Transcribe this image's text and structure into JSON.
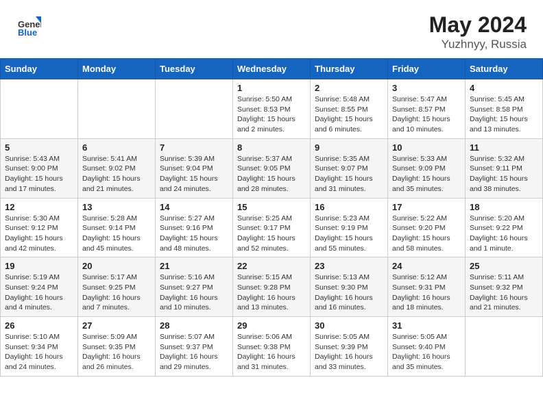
{
  "header": {
    "logo_general": "General",
    "logo_blue": "Blue",
    "title": "May 2024",
    "location": "Yuzhnyy, Russia"
  },
  "days_of_week": [
    "Sunday",
    "Monday",
    "Tuesday",
    "Wednesday",
    "Thursday",
    "Friday",
    "Saturday"
  ],
  "weeks": [
    [
      {
        "day": "",
        "info": ""
      },
      {
        "day": "",
        "info": ""
      },
      {
        "day": "",
        "info": ""
      },
      {
        "day": "1",
        "info": "Sunrise: 5:50 AM\nSunset: 8:53 PM\nDaylight: 15 hours\nand 2 minutes."
      },
      {
        "day": "2",
        "info": "Sunrise: 5:48 AM\nSunset: 8:55 PM\nDaylight: 15 hours\nand 6 minutes."
      },
      {
        "day": "3",
        "info": "Sunrise: 5:47 AM\nSunset: 8:57 PM\nDaylight: 15 hours\nand 10 minutes."
      },
      {
        "day": "4",
        "info": "Sunrise: 5:45 AM\nSunset: 8:58 PM\nDaylight: 15 hours\nand 13 minutes."
      }
    ],
    [
      {
        "day": "5",
        "info": "Sunrise: 5:43 AM\nSunset: 9:00 PM\nDaylight: 15 hours\nand 17 minutes."
      },
      {
        "day": "6",
        "info": "Sunrise: 5:41 AM\nSunset: 9:02 PM\nDaylight: 15 hours\nand 21 minutes."
      },
      {
        "day": "7",
        "info": "Sunrise: 5:39 AM\nSunset: 9:04 PM\nDaylight: 15 hours\nand 24 minutes."
      },
      {
        "day": "8",
        "info": "Sunrise: 5:37 AM\nSunset: 9:05 PM\nDaylight: 15 hours\nand 28 minutes."
      },
      {
        "day": "9",
        "info": "Sunrise: 5:35 AM\nSunset: 9:07 PM\nDaylight: 15 hours\nand 31 minutes."
      },
      {
        "day": "10",
        "info": "Sunrise: 5:33 AM\nSunset: 9:09 PM\nDaylight: 15 hours\nand 35 minutes."
      },
      {
        "day": "11",
        "info": "Sunrise: 5:32 AM\nSunset: 9:11 PM\nDaylight: 15 hours\nand 38 minutes."
      }
    ],
    [
      {
        "day": "12",
        "info": "Sunrise: 5:30 AM\nSunset: 9:12 PM\nDaylight: 15 hours\nand 42 minutes."
      },
      {
        "day": "13",
        "info": "Sunrise: 5:28 AM\nSunset: 9:14 PM\nDaylight: 15 hours\nand 45 minutes."
      },
      {
        "day": "14",
        "info": "Sunrise: 5:27 AM\nSunset: 9:16 PM\nDaylight: 15 hours\nand 48 minutes."
      },
      {
        "day": "15",
        "info": "Sunrise: 5:25 AM\nSunset: 9:17 PM\nDaylight: 15 hours\nand 52 minutes."
      },
      {
        "day": "16",
        "info": "Sunrise: 5:23 AM\nSunset: 9:19 PM\nDaylight: 15 hours\nand 55 minutes."
      },
      {
        "day": "17",
        "info": "Sunrise: 5:22 AM\nSunset: 9:20 PM\nDaylight: 15 hours\nand 58 minutes."
      },
      {
        "day": "18",
        "info": "Sunrise: 5:20 AM\nSunset: 9:22 PM\nDaylight: 16 hours\nand 1 minute."
      }
    ],
    [
      {
        "day": "19",
        "info": "Sunrise: 5:19 AM\nSunset: 9:24 PM\nDaylight: 16 hours\nand 4 minutes."
      },
      {
        "day": "20",
        "info": "Sunrise: 5:17 AM\nSunset: 9:25 PM\nDaylight: 16 hours\nand 7 minutes."
      },
      {
        "day": "21",
        "info": "Sunrise: 5:16 AM\nSunset: 9:27 PM\nDaylight: 16 hours\nand 10 minutes."
      },
      {
        "day": "22",
        "info": "Sunrise: 5:15 AM\nSunset: 9:28 PM\nDaylight: 16 hours\nand 13 minutes."
      },
      {
        "day": "23",
        "info": "Sunrise: 5:13 AM\nSunset: 9:30 PM\nDaylight: 16 hours\nand 16 minutes."
      },
      {
        "day": "24",
        "info": "Sunrise: 5:12 AM\nSunset: 9:31 PM\nDaylight: 16 hours\nand 18 minutes."
      },
      {
        "day": "25",
        "info": "Sunrise: 5:11 AM\nSunset: 9:32 PM\nDaylight: 16 hours\nand 21 minutes."
      }
    ],
    [
      {
        "day": "26",
        "info": "Sunrise: 5:10 AM\nSunset: 9:34 PM\nDaylight: 16 hours\nand 24 minutes."
      },
      {
        "day": "27",
        "info": "Sunrise: 5:09 AM\nSunset: 9:35 PM\nDaylight: 16 hours\nand 26 minutes."
      },
      {
        "day": "28",
        "info": "Sunrise: 5:07 AM\nSunset: 9:37 PM\nDaylight: 16 hours\nand 29 minutes."
      },
      {
        "day": "29",
        "info": "Sunrise: 5:06 AM\nSunset: 9:38 PM\nDaylight: 16 hours\nand 31 minutes."
      },
      {
        "day": "30",
        "info": "Sunrise: 5:05 AM\nSunset: 9:39 PM\nDaylight: 16 hours\nand 33 minutes."
      },
      {
        "day": "31",
        "info": "Sunrise: 5:05 AM\nSunset: 9:40 PM\nDaylight: 16 hours\nand 35 minutes."
      },
      {
        "day": "",
        "info": ""
      }
    ]
  ]
}
